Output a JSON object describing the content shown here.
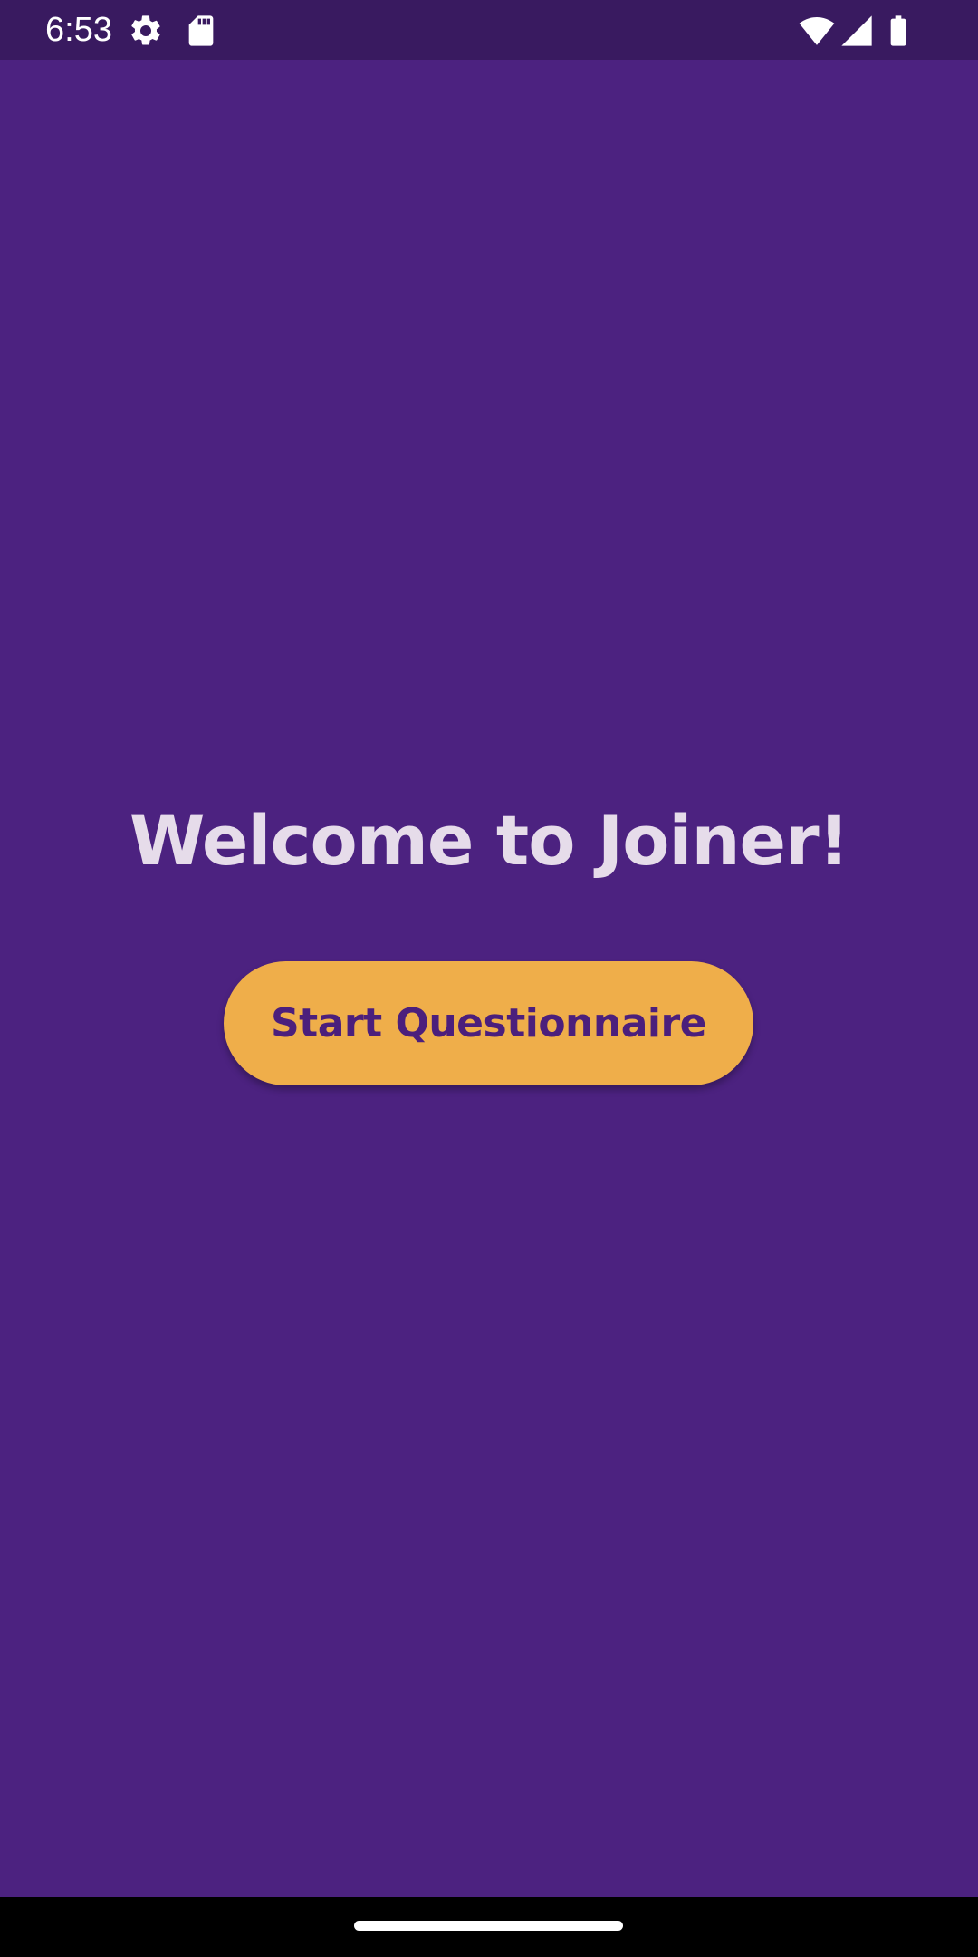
{
  "status_bar": {
    "time": "6:53",
    "icons": [
      "settings-icon",
      "sd-card-icon",
      "wifi-icon",
      "cell-signal-icon",
      "battery-icon"
    ]
  },
  "main": {
    "title": "Welcome to Joiner!",
    "start_button_label": "Start Questionnaire"
  },
  "colors": {
    "background": "#4c2280",
    "status_bar": "#391a60",
    "button": "#efae4a",
    "button_text": "#4b1f7c",
    "title_text": "#e6dcea"
  }
}
